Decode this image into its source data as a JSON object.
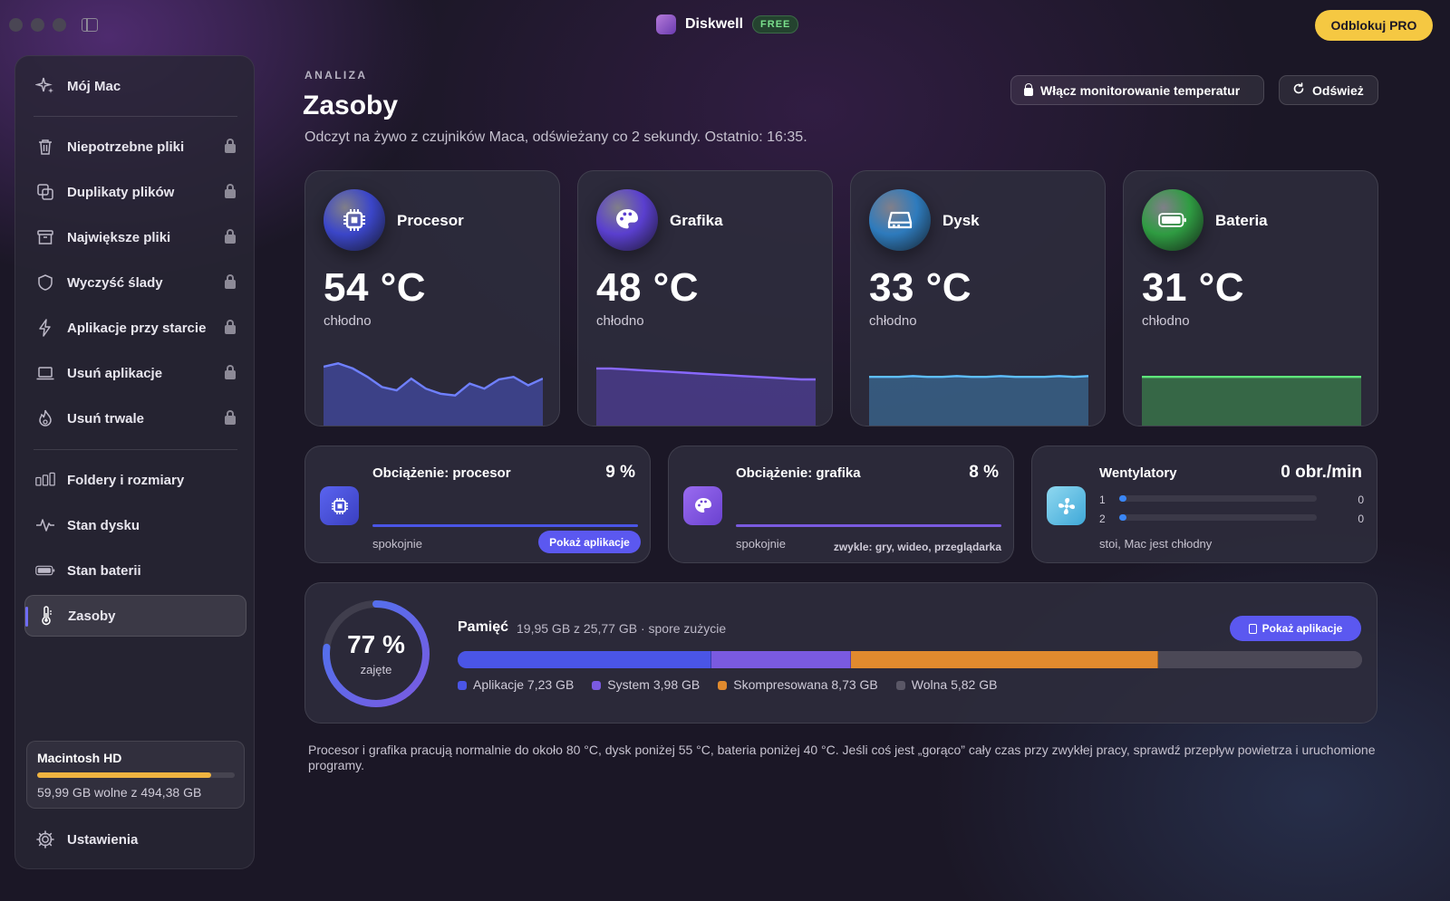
{
  "titlebar": {
    "app_name": "Diskwell",
    "badge": "FREE",
    "pro_button": "Odblokuj PRO"
  },
  "sidebar": {
    "top_item": {
      "label": "Mój Mac",
      "icon": "sparkles-icon"
    },
    "items": [
      {
        "label": "Niepotrzebne pliki",
        "icon": "trash-icon",
        "locked": true
      },
      {
        "label": "Duplikaty plików",
        "icon": "copy-icon",
        "locked": true
      },
      {
        "label": "Największe pliki",
        "icon": "archive-icon",
        "locked": true
      },
      {
        "label": "Wyczyść ślady",
        "icon": "shield-icon",
        "locked": true
      },
      {
        "label": "Aplikacje przy starcie",
        "icon": "bolt-icon",
        "locked": true
      },
      {
        "label": "Usuń aplikacje",
        "icon": "laptop-icon",
        "locked": true
      },
      {
        "label": "Usuń trwale",
        "icon": "flame-icon",
        "locked": true
      }
    ],
    "tools": [
      {
        "label": "Foldery i rozmiary",
        "icon": "bars-icon"
      },
      {
        "label": "Stan dysku",
        "icon": "pulse-icon"
      },
      {
        "label": "Stan baterii",
        "icon": "battery-icon"
      },
      {
        "label": "Zasoby",
        "icon": "thermometer-icon",
        "active": true
      }
    ],
    "disk": {
      "name": "Macintosh HD",
      "free_text": "59,99 GB wolne z 494,38 GB",
      "used_fraction": 0.879
    },
    "settings": "Ustawienia"
  },
  "header": {
    "eyebrow": "ANALIZA",
    "title": "Zasoby",
    "subtitle": "Odczyt na żywo z czujników Maca, odświeżany co 2 sekundy. Ostatnio: 16:35.",
    "temp_button": "Włącz monitorowanie temperatur",
    "refresh_button": "Odśwież"
  },
  "temps": [
    {
      "name": "Procesor",
      "value": "54 °C",
      "status": "chłodno",
      "color": "#4a55c8",
      "orb": "#3b46c9",
      "icon": "cpu-icon",
      "history": [
        72,
        76,
        70,
        60,
        48,
        44,
        58,
        46,
        40,
        38,
        52,
        46,
        57,
        60,
        50,
        58
      ]
    },
    {
      "name": "Grafika",
      "value": "48 °C",
      "status": "chłodno",
      "color": "#5b45b8",
      "orb": "#5a3fcf",
      "icon": "palette-icon",
      "history": [
        70,
        70,
        69,
        68,
        67,
        66,
        65,
        64,
        63,
        62,
        61,
        60,
        59,
        58,
        57,
        57
      ]
    },
    {
      "name": "Dysk",
      "value": "33 °C",
      "status": "chłodno",
      "color": "#3f7fb3",
      "orb": "#2e7bbd",
      "icon": "drive-icon",
      "history": [
        60,
        60,
        60,
        61,
        60,
        60,
        61,
        60,
        60,
        61,
        60,
        60,
        60,
        61,
        60,
        61
      ]
    },
    {
      "name": "Bateria",
      "value": "31 °C",
      "status": "chłodno",
      "color": "#3f9a52",
      "orb": "#2f9c42",
      "icon": "battery-full-icon",
      "history": [
        60,
        60,
        60,
        60,
        60,
        60,
        60,
        60,
        60,
        60,
        60,
        60,
        60,
        60,
        60,
        60
      ]
    }
  ],
  "loads": {
    "cpu": {
      "title": "Obciążenie: procesor",
      "value": "9 %",
      "status": "spokojnie",
      "button": "Pokaż aplikacje"
    },
    "gpu": {
      "title": "Obciążenie: grafika",
      "value": "8 %",
      "status": "spokojnie",
      "hint": "zwykle: gry, wideo, przeglądarka"
    },
    "fans": {
      "title": "Wentylatory",
      "value": "0 obr./min",
      "rows": [
        {
          "id": "1",
          "rpm": "0"
        },
        {
          "id": "2",
          "rpm": "0"
        }
      ],
      "status": "stoi, Mac jest chłodny"
    }
  },
  "memory": {
    "percent": "77 %",
    "percent_label": "zajęte",
    "used_fraction": 0.77,
    "title": "Pamięć",
    "subtitle": "19,95 GB z 25,77 GB · spore zużycie",
    "button": "Pokaż aplikacje",
    "segments": [
      {
        "label": "Aplikacje 7,23 GB",
        "gb": 7.23,
        "color": "#4a55e6"
      },
      {
        "label": "System 3,98 GB",
        "gb": 3.98,
        "color": "#7a5ae0"
      },
      {
        "label": "Skompresowana 8,73 GB",
        "gb": 8.73,
        "color": "#e08a2e"
      },
      {
        "label": "Wolna 5,82 GB",
        "gb": 5.82,
        "color": "#4b4856"
      }
    ]
  },
  "footnote": "Procesor i grafika pracują normalnie do około 80 °C, dysk poniżej 55 °C, bateria poniżej 40 °C. Jeśli coś jest „gorąco” cały czas przy zwykłej pracy, sprawdź przepływ powietrza i uruchomione programy."
}
